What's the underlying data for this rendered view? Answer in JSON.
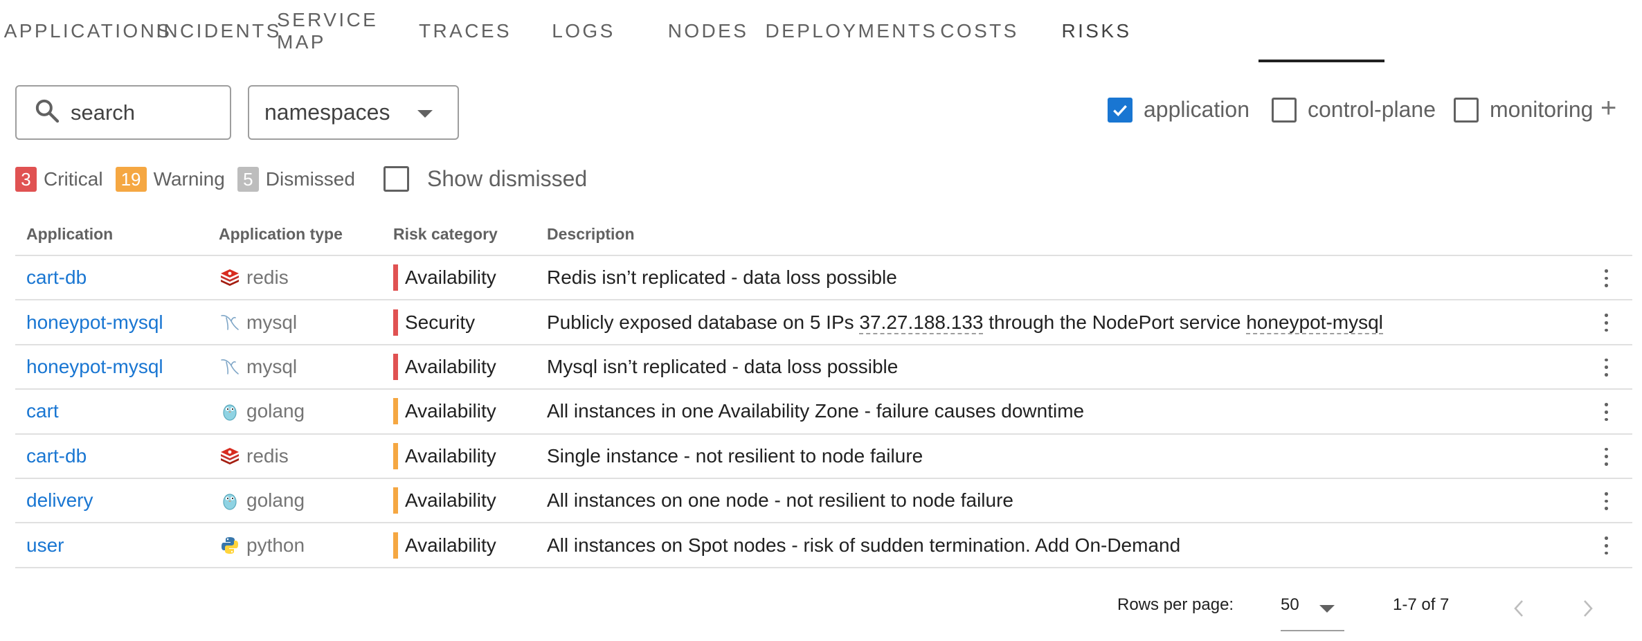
{
  "tabs": [
    {
      "label": "APPLICATIONS"
    },
    {
      "label": "INCIDENTS"
    },
    {
      "label": "SERVICE MAP"
    },
    {
      "label": "TRACES"
    },
    {
      "label": "LOGS"
    },
    {
      "label": "NODES"
    },
    {
      "label": "DEPLOYMENTS"
    },
    {
      "label": "COSTS"
    },
    {
      "label": "RISKS",
      "active": true
    }
  ],
  "filters": {
    "search_placeholder": "search",
    "namespaces_label": "namespaces",
    "categories": [
      {
        "label": "application",
        "checked": true
      },
      {
        "label": "control-plane",
        "checked": false
      },
      {
        "label": "monitoring",
        "checked": false
      }
    ],
    "add_label": "+"
  },
  "summary": {
    "critical_count": "3",
    "critical_label": "Critical",
    "warning_count": "19",
    "warning_label": "Warning",
    "dismissed_count": "5",
    "dismissed_label": "Dismissed",
    "show_dismissed_label": "Show dismissed"
  },
  "table": {
    "headers": {
      "application": "Application",
      "type": "Application type",
      "category": "Risk category",
      "description": "Description"
    },
    "rows": [
      {
        "app": "cart-db",
        "type": "redis",
        "type_icon": "redis-icon",
        "severity": "critical",
        "category": "Availability",
        "desc": "Redis isn’t replicated - data loss possible"
      },
      {
        "app": "honeypot-mysql",
        "type": "mysql",
        "type_icon": "mysql-icon",
        "severity": "critical",
        "category": "Security",
        "desc_pre": "Publicly exposed database on 5 IPs ",
        "desc_ip": "37.27.188.133",
        "desc_mid": " through the NodePort service ",
        "desc_svc": "honeypot-mysql"
      },
      {
        "app": "honeypot-mysql",
        "type": "mysql",
        "type_icon": "mysql-icon",
        "severity": "critical",
        "category": "Availability",
        "desc": "Mysql isn’t replicated - data loss possible"
      },
      {
        "app": "cart",
        "type": "golang",
        "type_icon": "golang-icon",
        "severity": "warning",
        "category": "Availability",
        "desc": "All instances in one Availability Zone - failure causes downtime"
      },
      {
        "app": "cart-db",
        "type": "redis",
        "type_icon": "redis-icon",
        "severity": "warning",
        "category": "Availability",
        "desc": "Single instance - not resilient to node failure"
      },
      {
        "app": "delivery",
        "type": "golang",
        "type_icon": "golang-icon",
        "severity": "warning",
        "category": "Availability",
        "desc": "All instances on one node - not resilient to node failure"
      },
      {
        "app": "user",
        "type": "python",
        "type_icon": "python-icon",
        "severity": "warning",
        "category": "Availability",
        "desc": "All instances on Spot nodes - risk of sudden termination. Add On-Demand"
      }
    ]
  },
  "pagination": {
    "rows_per_page_label": "Rows per page:",
    "rows_per_page": "50",
    "range": "1-7 of 7"
  },
  "colors": {
    "critical": "#e05252",
    "warning": "#f5a742",
    "dismissed": "#bdbdbd",
    "link": "#1976d2"
  }
}
